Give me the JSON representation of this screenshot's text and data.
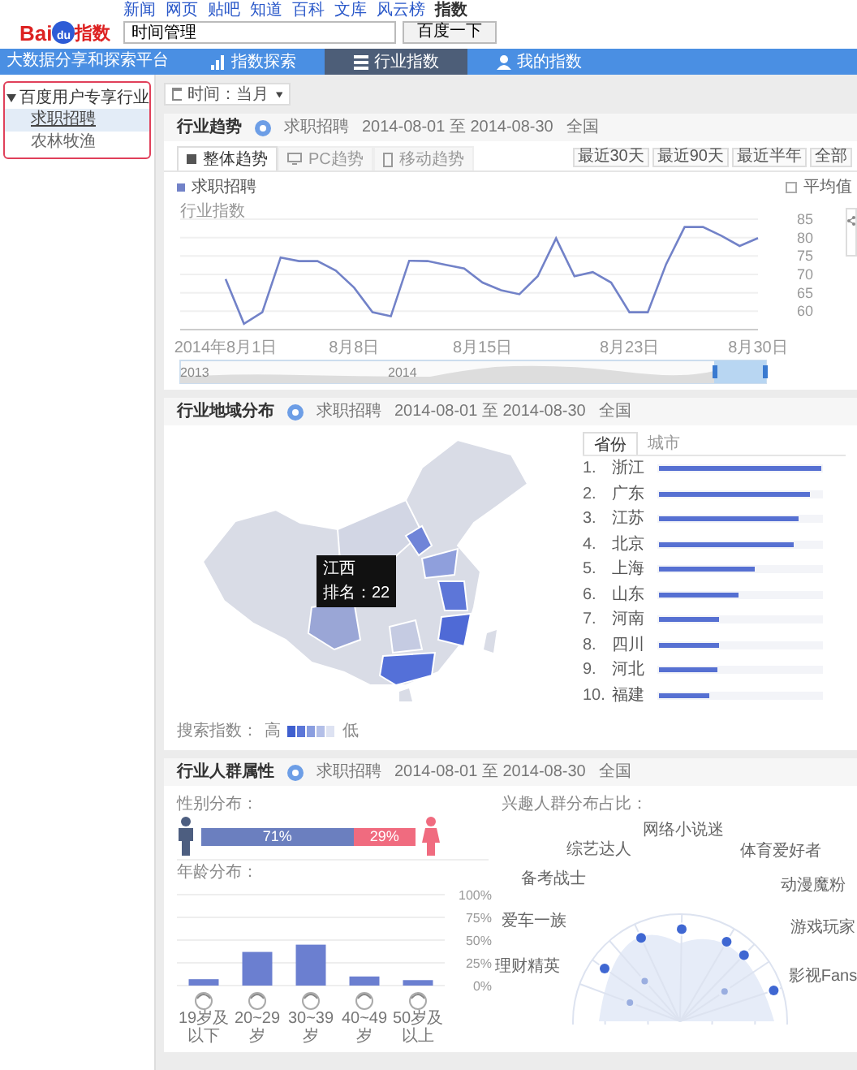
{
  "top_links": [
    {
      "label": "新闻",
      "selected": false
    },
    {
      "label": "网页",
      "selected": false
    },
    {
      "label": "贴吧",
      "selected": false
    },
    {
      "label": "知道",
      "selected": false
    },
    {
      "label": "百科",
      "selected": false
    },
    {
      "label": "文库",
      "selected": false
    },
    {
      "label": "风云榜",
      "selected": false
    },
    {
      "label": "指数",
      "selected": true
    }
  ],
  "logo": {
    "left": "Bai",
    "paw": "du",
    "right": "指数"
  },
  "search": {
    "value": "时间管理",
    "button": "百度一下"
  },
  "nav": {
    "title": "大数据分享和探索平台",
    "items": [
      {
        "label": "指数探索",
        "kind": "explore",
        "selected": false
      },
      {
        "label": "行业指数",
        "kind": "industry",
        "selected": true
      },
      {
        "label": "我的指数",
        "kind": "mine",
        "selected": false
      }
    ]
  },
  "sidebar": {
    "items": [
      {
        "label": "百度用户专享行业",
        "expanded": true,
        "children": [
          {
            "label": "求职招聘",
            "selected": true
          },
          {
            "label": "农林牧渔",
            "selected": false
          }
        ]
      }
    ]
  },
  "time_select": {
    "value": "时间：当月"
  },
  "trend": {
    "title": "行业趋势",
    "meta": [
      "求职招聘",
      "2014-08-01 至 2014-08-30",
      "全国"
    ],
    "tabs": [
      {
        "label": "整体趋势",
        "kind": "all",
        "selected": true
      },
      {
        "label": "PC趋势",
        "kind": "pc",
        "selected": false
      },
      {
        "label": "移动趋势",
        "kind": "mobile",
        "selected": false
      }
    ],
    "ranges": [
      "最近30天",
      "最近90天",
      "最近半年",
      "全部"
    ],
    "average": {
      "label": "平均值",
      "checked": false
    },
    "chart_data": {
      "type": "line",
      "ylabel": "行业指数",
      "categories": [
        "2014年8月1日",
        null,
        null,
        null,
        null,
        null,
        null,
        "8月8日",
        null,
        null,
        null,
        null,
        null,
        null,
        "8月15日",
        null,
        null,
        null,
        null,
        null,
        null,
        null,
        "8月23日",
        null,
        null,
        null,
        null,
        null,
        null,
        "8月30日"
      ],
      "grid": true,
      "ylim": [
        55,
        85
      ],
      "yticks": [
        60,
        65,
        70,
        75,
        80,
        85
      ],
      "series": [
        {
          "name": "求职招聘",
          "color": "#7282c8",
          "values": [
            68.7,
            56.6,
            59.7,
            74.6,
            73.6,
            73.6,
            71,
            66.4,
            59.7,
            58.6,
            73.7,
            73.6,
            72.6,
            71.6,
            67.8,
            65.7,
            64.6,
            69.5,
            79.8,
            69.5,
            70.6,
            67.8,
            59.7,
            59.7,
            72.8,
            82.9,
            82.9,
            80.5,
            77.7,
            79.9
          ]
        }
      ]
    },
    "navigator": {
      "labels": [
        "2013",
        "2014"
      ]
    }
  },
  "region": {
    "title": "行业地域分布",
    "meta": [
      "求职招聘",
      "2014-08-01 至 2014-08-30",
      "全国"
    ],
    "tooltip": {
      "title": "江西",
      "text": "排名：22"
    },
    "legend": {
      "label": "搜索指数：",
      "high": "高",
      "low": "低"
    },
    "tabs": [
      {
        "label": "省份",
        "selected": true
      },
      {
        "label": "城市",
        "selected": false
      }
    ],
    "ranking": [
      {
        "rank": "1.",
        "name": "浙江",
        "level": 1
      },
      {
        "rank": "2.",
        "name": "广东",
        "level": 0.93
      },
      {
        "rank": "3.",
        "name": "江苏",
        "level": 0.86
      },
      {
        "rank": "4.",
        "name": "北京",
        "level": 0.83
      },
      {
        "rank": "5.",
        "name": "上海",
        "level": 0.59
      },
      {
        "rank": "6.",
        "name": "山东",
        "level": 0.49
      },
      {
        "rank": "7.",
        "name": "河南",
        "level": 0.37
      },
      {
        "rank": "8.",
        "name": "四川",
        "level": 0.37
      },
      {
        "rank": "9.",
        "name": "河北",
        "level": 0.36
      },
      {
        "rank": "10.",
        "name": "福建",
        "level": 0.31
      }
    ]
  },
  "crowd": {
    "title": "行业人群属性",
    "meta": [
      "求职招聘",
      "2014-08-01 至 2014-08-30",
      "全国"
    ],
    "gender": {
      "label": "性别分布：",
      "level": 0.71,
      "male": "71%",
      "female": "29%"
    },
    "age": {
      "label": "年龄分布：",
      "chart_data": {
        "type": "bar",
        "grid": true,
        "categories": [
          "19岁及以下",
          "20~29岁",
          "30~39岁",
          "40~49岁",
          "50岁及以上"
        ],
        "values": [
          7,
          37,
          45,
          10,
          6
        ],
        "ylim": [
          0,
          100
        ],
        "yticks": [
          {
            "value": 0,
            "label": "0%"
          },
          {
            "value": 25,
            "label": "25%"
          },
          {
            "value": 50,
            "label": "50%"
          },
          {
            "value": 75,
            "label": "75%"
          },
          {
            "value": 100,
            "label": "100%"
          }
        ]
      }
    },
    "interests": {
      "label": "兴趣人群分布占比：",
      "items": [
        "网络小说迷",
        "综艺达人",
        "体育爱好者",
        "备考战士",
        "动漫魔粉",
        "爱车一族",
        "游戏玩家",
        "理财精英",
        "影视Fans"
      ]
    }
  }
}
